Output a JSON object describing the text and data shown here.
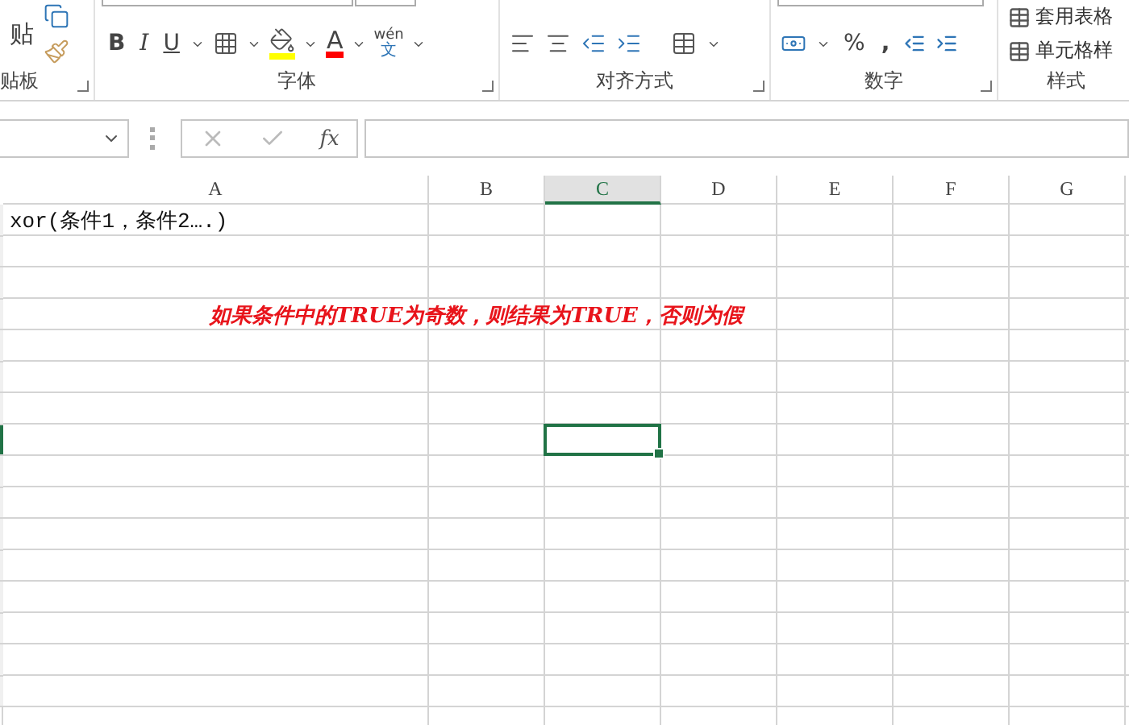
{
  "ribbon": {
    "clipboard": {
      "paste_label": "贴",
      "group_label": "贴板"
    },
    "font": {
      "bold": "B",
      "italic": "I",
      "underline": "U",
      "font_color": "A",
      "phonetic_top": "wén",
      "phonetic_bottom": "文",
      "group_label": "字体"
    },
    "alignment": {
      "group_label": "对齐方式"
    },
    "number": {
      "percent": "%",
      "comma": ",",
      "group_label": "数字"
    },
    "styles": {
      "items": [
        "套用表格",
        "单元格样"
      ],
      "group_label": "样式"
    }
  },
  "formula_bar": {
    "function_label": "fx"
  },
  "columns": [
    {
      "label": "A",
      "selected": false
    },
    {
      "label": "B",
      "selected": false
    },
    {
      "label": "C",
      "selected": true
    },
    {
      "label": "D",
      "selected": false
    },
    {
      "label": "E",
      "selected": false
    },
    {
      "label": "F",
      "selected": false
    },
    {
      "label": "G",
      "selected": false
    }
  ],
  "rows": [
    {
      "selected": false,
      "cells": [
        {
          "text": "xor(条件1，条件2….)",
          "kind": "plain"
        }
      ]
    },
    {
      "selected": false,
      "cells": []
    },
    {
      "selected": false,
      "cells": []
    },
    {
      "selected": false,
      "cells": [
        {
          "text": "如果条件中的TRUE为奇数，则结果为TRUE，否则为假",
          "kind": "note"
        }
      ]
    },
    {
      "selected": false,
      "cells": []
    },
    {
      "selected": false,
      "cells": []
    },
    {
      "selected": false,
      "cells": []
    },
    {
      "selected": true,
      "cells": []
    },
    {
      "selected": false,
      "cells": []
    },
    {
      "selected": false,
      "cells": []
    },
    {
      "selected": false,
      "cells": []
    },
    {
      "selected": false,
      "cells": []
    },
    {
      "selected": false,
      "cells": []
    },
    {
      "selected": false,
      "cells": []
    },
    {
      "selected": false,
      "cells": []
    },
    {
      "selected": false,
      "cells": []
    }
  ]
}
